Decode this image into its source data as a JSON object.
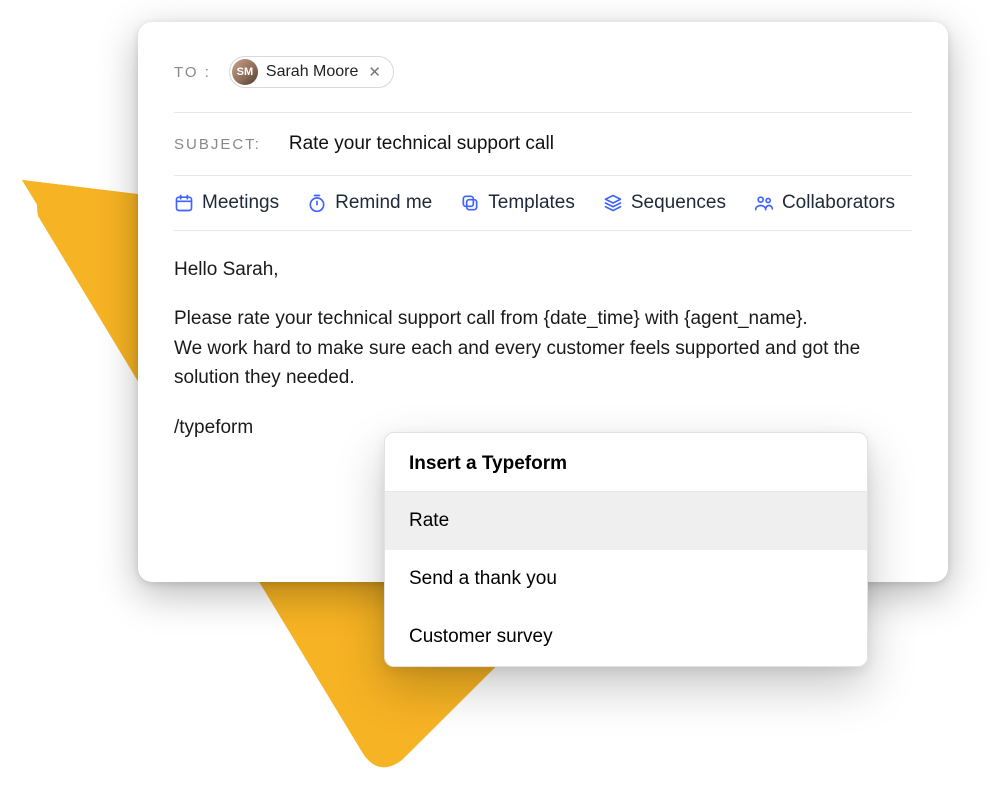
{
  "fields": {
    "to_label": "TO :",
    "subject_label": "SUBJECT:"
  },
  "recipient": {
    "name": "Sarah Moore",
    "initials": "SM"
  },
  "subject": "Rate your technical support call",
  "toolbar": {
    "meetings": "Meetings",
    "remind": "Remind me",
    "templates": "Templates",
    "sequences": "Sequences",
    "collaborators": "Collaborators"
  },
  "body": {
    "greeting": "Hello Sarah,",
    "line1": "Please rate your technical support call from {date_time} with {agent_name}.",
    "line2": "We work hard to make sure each and every customer feels supported and got the solution they needed.",
    "slash": "/typeform"
  },
  "popup": {
    "title": "Insert a Typeform",
    "items": [
      "Rate",
      "Send a thank you",
      "Customer survey"
    ],
    "selected_index": 0
  },
  "colors": {
    "accent_blue": "#3e63ff",
    "triangle": "#f6b323"
  }
}
